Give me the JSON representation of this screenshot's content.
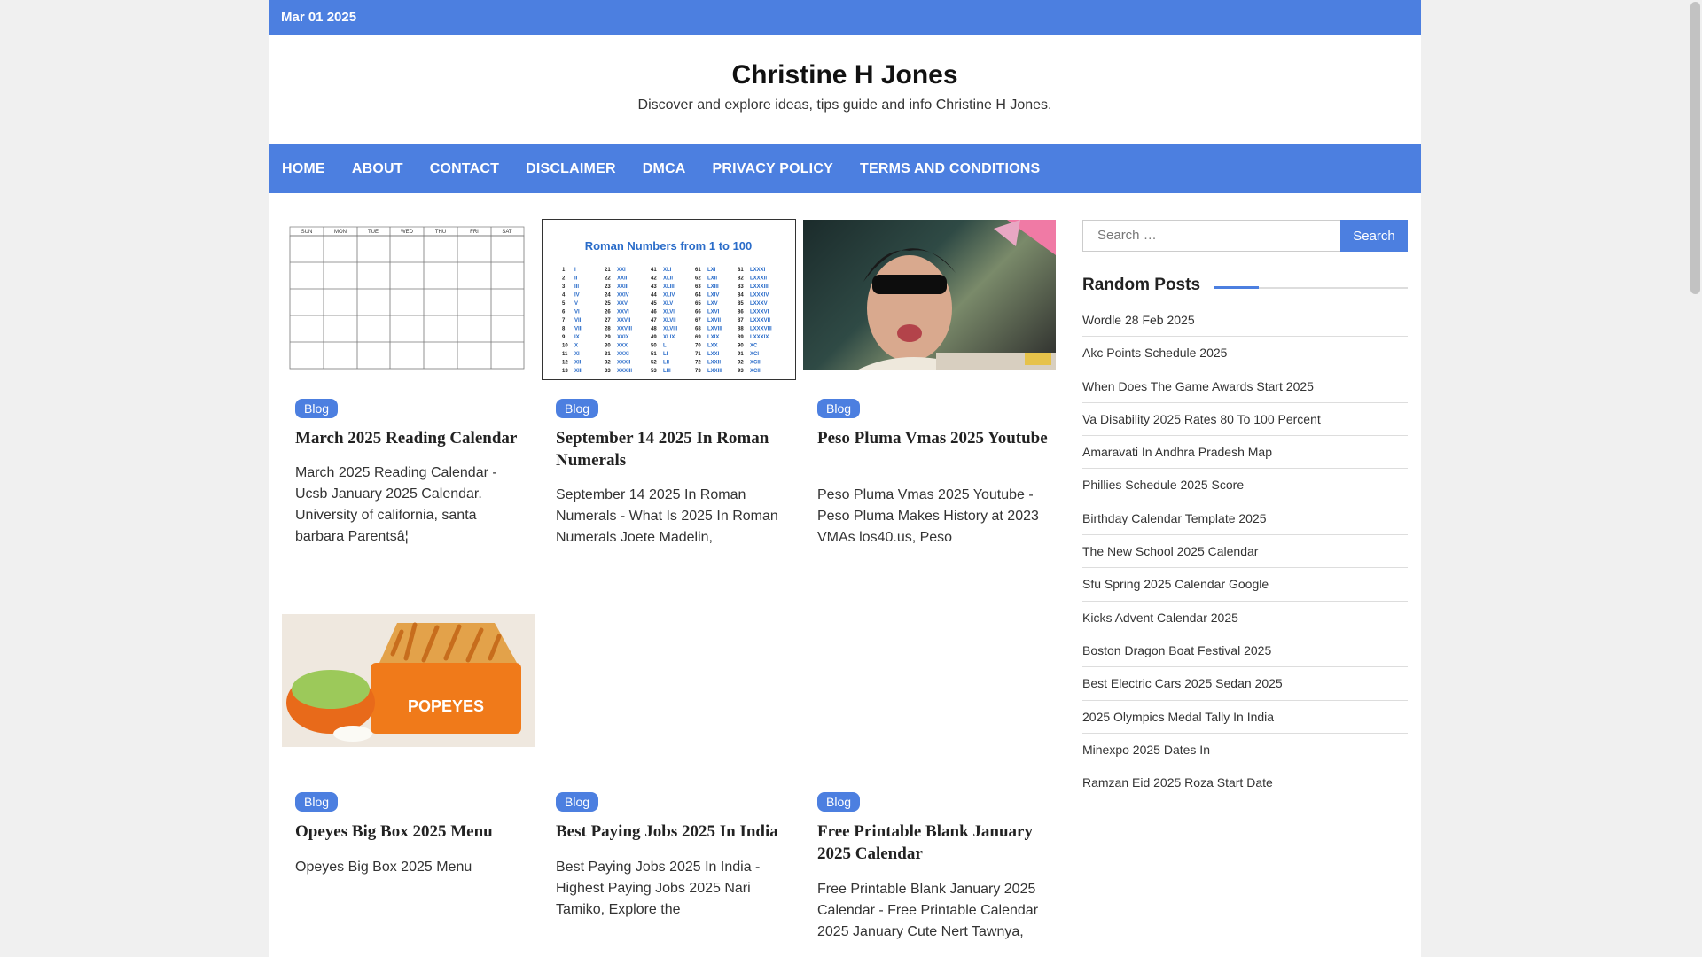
{
  "topbar": {
    "date": "Mar 01 2025"
  },
  "site": {
    "title": "Christine H Jones",
    "description": "Discover and explore ideas, tips guide and info Christine H Jones."
  },
  "nav": [
    "HOME",
    "ABOUT",
    "CONTACT",
    "DISCLAIMER",
    "DMCA",
    "PRIVACY POLICY",
    "TERMS AND CONDITIONS"
  ],
  "posts": [
    {
      "category": "Blog",
      "title": "March 2025 Reading Calendar",
      "excerpt": "March 2025 Reading Calendar - Ucsb January 2025 Calendar. University of california, santa barbara Parentsâ¦"
    },
    {
      "category": "Blog",
      "title": "September 14 2025 In Roman Numerals",
      "excerpt": "September 14 2025 In Roman Numerals - What Is 2025 In Roman Numerals Joete Madelin,",
      "image_heading": "Roman Numbers from 1 to 100"
    },
    {
      "category": "Blog",
      "title": "Peso Pluma Vmas 2025 Youtube",
      "excerpt": "Peso Pluma Vmas 2025 Youtube - Peso Pluma Makes History at 2023 VMAs los40.us, Peso"
    },
    {
      "category": "Blog",
      "title": "Opeyes Big Box 2025 Menu",
      "excerpt": "Opeyes Big Box 2025 Menu",
      "image_text": "POPEYES"
    },
    {
      "category": "Blog",
      "title": "Best Paying Jobs 2025 In India",
      "excerpt": "Best Paying Jobs 2025 In India - Highest Paying Jobs 2025 Nari Tamiko, Explore the"
    },
    {
      "category": "Blog",
      "title": "Free Printable Blank January 2025 Calendar",
      "excerpt": "Free Printable Blank January 2025 Calendar - Free Printable Calendar 2025 January Cute Nert Tawnya,"
    }
  ],
  "search": {
    "placeholder": "Search …",
    "button": "Search"
  },
  "random_posts": {
    "heading": "Random Posts",
    "items": [
      "Wordle 28 Feb 2025",
      "Akc Points Schedule 2025",
      "When Does The Game Awards Start 2025",
      "Va Disability 2025 Rates 80 To 100 Percent",
      "Amaravati In Andhra Pradesh Map",
      "Phillies Schedule 2025 Score",
      "Birthday Calendar Template 2025",
      "The New School 2025 Calendar",
      "Sfu Spring 2025 Calendar Google",
      "Kicks Advent Calendar 2025",
      "Boston Dragon Boat Festival 2025",
      "Best Electric Cars 2025 Sedan 2025",
      "2025 Olympics Medal Tally In India",
      "Minexpo 2025 Dates In",
      "Ramzan Eid 2025 Roza Start Date"
    ]
  },
  "calendar_days": [
    "SUN",
    "MON",
    "TUE",
    "WED",
    "THU",
    "FRI",
    "SAT"
  ],
  "roman_columns": {
    "n1": [
      "1",
      "2",
      "3",
      "4",
      "5",
      "6",
      "7",
      "8",
      "9",
      "10",
      "11",
      "12",
      "13"
    ],
    "r1": [
      "I",
      "II",
      "III",
      "IV",
      "V",
      "VI",
      "VII",
      "VIII",
      "IX",
      "X",
      "XI",
      "XII",
      "XIII"
    ],
    "n2": [
      "21",
      "22",
      "23",
      "24",
      "25",
      "26",
      "27",
      "28",
      "29",
      "30",
      "31",
      "32",
      "33"
    ],
    "r2": [
      "XXI",
      "XXII",
      "XXIII",
      "XXIV",
      "XXV",
      "XXVI",
      "XXVII",
      "XXVIII",
      "XXIX",
      "XXX",
      "XXXI",
      "XXXII",
      "XXXIII"
    ],
    "n3": [
      "41",
      "42",
      "43",
      "44",
      "45",
      "46",
      "47",
      "48",
      "49",
      "50",
      "51",
      "52",
      "53"
    ],
    "r3": [
      "XLI",
      "XLII",
      "XLIII",
      "XLIV",
      "XLV",
      "XLVI",
      "XLVII",
      "XLVIII",
      "XLIX",
      "L",
      "LI",
      "LII",
      "LIII"
    ],
    "n4": [
      "61",
      "62",
      "63",
      "64",
      "65",
      "66",
      "67",
      "68",
      "69",
      "70",
      "71",
      "72",
      "73"
    ],
    "r4": [
      "LXI",
      "LXII",
      "LXIII",
      "LXIV",
      "LXV",
      "LXVI",
      "LXVII",
      "LXVIII",
      "LXIX",
      "LXX",
      "LXXI",
      "LXXII",
      "LXXIII"
    ],
    "n5": [
      "81",
      "82",
      "83",
      "84",
      "85",
      "86",
      "87",
      "88",
      "89",
      "90",
      "91",
      "92",
      "93"
    ],
    "r5": [
      "LXXXI",
      "LXXXII",
      "LXXXIII",
      "LXXXIV",
      "LXXXV",
      "LXXXVI",
      "LXXXVII",
      "LXXXVIII",
      "LXXXIX",
      "XC",
      "XCI",
      "XCII",
      "XCIII"
    ]
  }
}
